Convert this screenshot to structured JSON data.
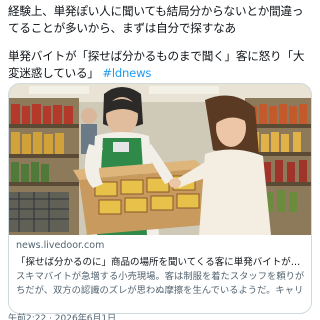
{
  "post": {
    "paragraph1": "経験上、単発ぽい人に聞いても結局分からないとか間違ってることが多いから、まずは自分で探すなあ",
    "paragraph2": "単発バイトが「探せば分かるものまで聞く」客に怒り「大変迷惑している」",
    "hashtag": "#ldnews"
  },
  "card": {
    "domain": "news.livedoor.com",
    "title": "「探せば分かるのに」商品の場所を聞いてくる客に単発バイトが怒り「大変迷惑している」",
    "description": "スキマバイトが急増する小売現場。客は制服を着たスタッフを頼りがちだが、双方の認識のズレが思わぬ摩擦を生んでいるようだ。キャリコネニュース"
  },
  "timestamp": "午前2:22 · 2026年6月1日",
  "colors": {
    "link": "#1d9bf0",
    "border": "#cfd9de",
    "secondary_text": "#536471"
  }
}
